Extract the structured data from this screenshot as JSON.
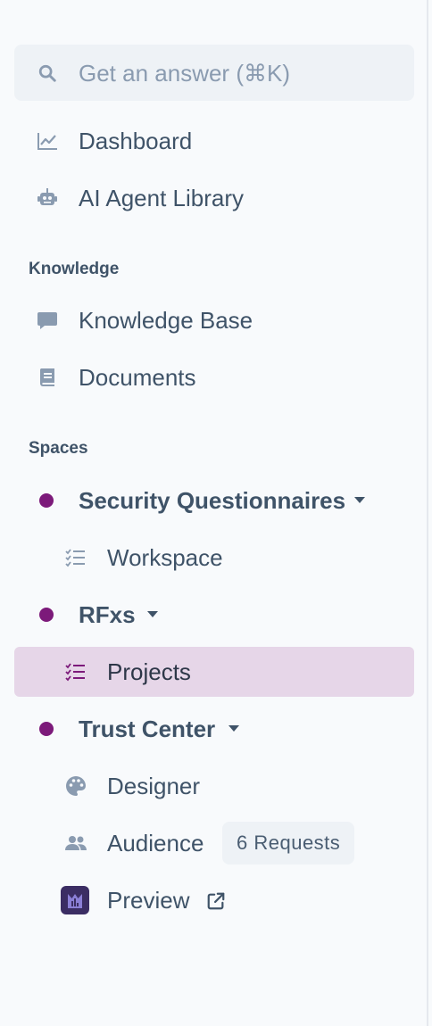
{
  "search": {
    "placeholder": "Get an answer (⌘K)",
    "icon": "search-icon"
  },
  "nav": {
    "dashboard": "Dashboard",
    "ai_agent_library": "AI Agent Library"
  },
  "sections": {
    "knowledge": "Knowledge",
    "spaces": "Spaces"
  },
  "knowledge": {
    "knowledge_base": "Knowledge Base",
    "documents": "Documents"
  },
  "spaces": {
    "security_questionnaires": {
      "label": "Security Questionnaires",
      "workspace": "Workspace"
    },
    "rfxs": {
      "label": "RFxs",
      "projects": "Projects"
    },
    "trust_center": {
      "label": "Trust Center",
      "designer": "Designer",
      "audience": "Audience",
      "audience_badge": "6 Requests",
      "preview": "Preview"
    }
  },
  "colors": {
    "accent": "#7c1a7a",
    "active_bg": "#e6d6e8",
    "text": "#3f5368",
    "icon": "#8a9bb0"
  }
}
